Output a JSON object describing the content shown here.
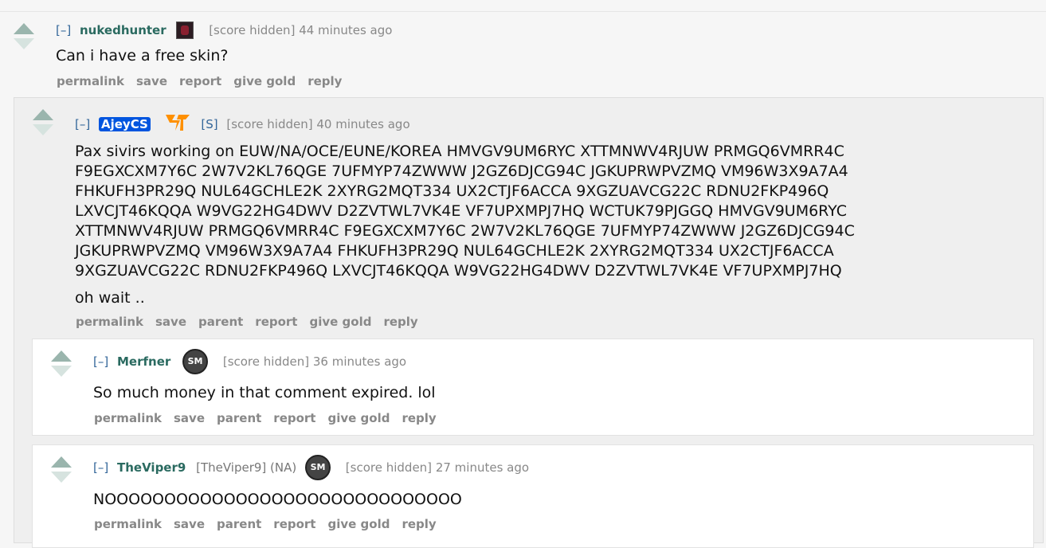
{
  "comments": [
    {
      "toggle": "[–]",
      "author": "nukedhunter",
      "score": "[score hidden]",
      "time": "44 minutes ago",
      "body": "Can i have a free skin?",
      "buttons": [
        "permalink",
        "save",
        "report",
        "give gold",
        "reply"
      ]
    },
    {
      "toggle": "[–]",
      "author": "AjeyCS",
      "submitter_tag": "[S]",
      "score": "[score hidden]",
      "time": "40 minutes ago",
      "body": "Pax sivirs working on EUW/NA/OCE/EUNE/KOREA HMVGV9UM6RYC XTTMNWV4RJUW PRMGQ6VMRR4C F9EGXCXM7Y6C 2W7V2KL76QGE 7UFMYP74ZWWW J2GZ6DJCG94C JGKUPRWPVZMQ VM96W3X9A7A4 FHKUFH3PR29Q NUL64GCHLE2K 2XYRG2MQT334 UX2CTJF6ACCA 9XGZUAVCG22C RDNU2FKP496Q LXVCJT46KQQA W9VG22HG4DWV D2ZVTWL7VK4E VF7UPXMPJ7HQ WCTUK79PJGGQ HMVGV9UM6RYC XTTMNWV4RJUW PRMGQ6VMRR4C F9EGXCXM7Y6C 2W7V2KL76QGE 7UFMYP74ZWWW J2GZ6DJCG94C JGKUPRWPVZMQ VM96W3X9A7A4 FHKUFH3PR29Q NUL64GCHLE2K 2XYRG2MQT334 UX2CTJF6ACCA 9XGZUAVCG22C RDNU2FKP496Q LXVCJT46KQQA W9VG22HG4DWV D2ZVTWL7VK4E VF7UPXMPJ7HQ",
      "body2": "oh wait ..",
      "buttons": [
        "permalink",
        "save",
        "parent",
        "report",
        "give gold",
        "reply"
      ]
    },
    {
      "toggle": "[–]",
      "author": "Merfner",
      "avatar_text": "SM",
      "score": "[score hidden]",
      "time": "36 minutes ago",
      "body": "So much money in that comment expired. lol",
      "buttons": [
        "permalink",
        "save",
        "parent",
        "report",
        "give gold",
        "reply"
      ]
    },
    {
      "toggle": "[–]",
      "author": "TheViper9",
      "flair": "[TheViper9] (NA)",
      "avatar_text": "SM",
      "score": "[score hidden]",
      "time": "27 minutes ago",
      "body": "NOOOOOOOOOOOOOOOOOOOOOOOOOOOOOO",
      "buttons": [
        "permalink",
        "save",
        "parent",
        "report",
        "give gold",
        "reply"
      ]
    }
  ],
  "icons": {
    "upvote": "upvote-arrow-icon",
    "downvote": "downvote-arrow-icon",
    "fnatic": "fnatic-flair-icon",
    "tsm": "tsm-flair-icon"
  },
  "colors": {
    "author": "#2a6a60",
    "op_badge": "#0055df",
    "fnatic_orange": "#ff9000"
  }
}
